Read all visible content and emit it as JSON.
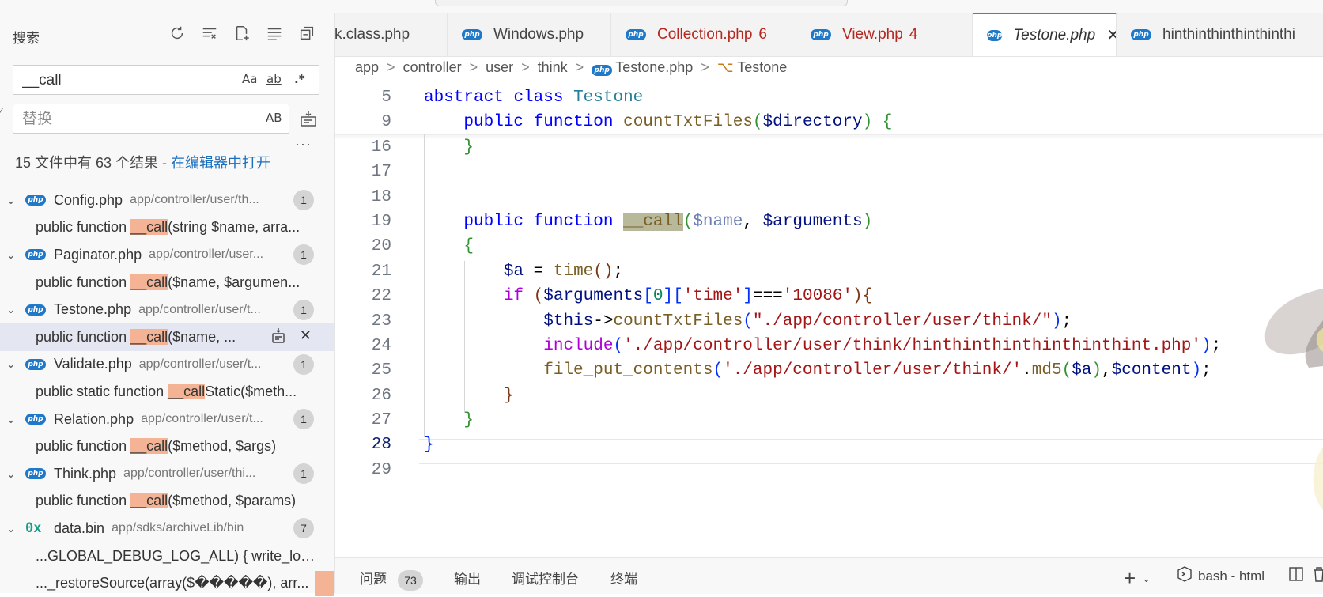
{
  "sidebar": {
    "title": "搜索",
    "search": {
      "value": "__call",
      "opt_case": "Aa",
      "opt_word": "ab",
      "opt_regex": ".*"
    },
    "replace": {
      "placeholder": "替换",
      "opt_preserve": "AB"
    },
    "more": "···",
    "summary": "15 文件中有 63 个结果 - ",
    "summary_link": "在编辑器中打开",
    "results": [
      {
        "file": "Config.php",
        "path": "app/controller/user/th...",
        "count": "1",
        "icon": "php",
        "match_pre": "public function ",
        "match_hl": "__call",
        "match_post": "(string $name, arra...",
        "selected": false
      },
      {
        "file": "Paginator.php",
        "path": "app/controller/user...",
        "count": "1",
        "icon": "php",
        "match_pre": "public function ",
        "match_hl": "__call",
        "match_post": "($name, $argumen...",
        "selected": false
      },
      {
        "file": "Testone.php",
        "path": "app/controller/user/t...",
        "count": "1",
        "icon": "php",
        "match_pre": "public function ",
        "match_hl": "__call",
        "match_post": "($name, ...",
        "selected": true
      },
      {
        "file": "Validate.php",
        "path": "app/controller/user/t...",
        "count": "1",
        "icon": "php",
        "match_pre": "public static function ",
        "match_hl": "__call",
        "match_post": "Static($meth...",
        "selected": false
      },
      {
        "file": "Relation.php",
        "path": "app/controller/user/t...",
        "count": "1",
        "icon": "php",
        "match_pre": "public function ",
        "match_hl": "__call",
        "match_post": "($method, $args)",
        "selected": false
      },
      {
        "file": "Think.php",
        "path": "app/controller/user/thi...",
        "count": "1",
        "icon": "php",
        "match_pre": "public function ",
        "match_hl": "__call",
        "match_post": "($method, $params)",
        "selected": false
      },
      {
        "file": "data.bin",
        "path": "app/sdks/archiveLib/bin",
        "count": "7",
        "icon": "0x",
        "match_pre": "...GLOBAL_DEBUG_LOG_ALL) { write_log(...",
        "match_hl": "",
        "match_post": "",
        "selected": false
      }
    ],
    "extra_match": "..._restoreSource(array($�����), arr..."
  },
  "tabs": [
    {
      "label": "k.class.php",
      "badge": "",
      "modified": false,
      "active": false,
      "icon": false
    },
    {
      "label": "Windows.php",
      "badge": "",
      "modified": false,
      "active": false,
      "icon": true
    },
    {
      "label": "Collection.php",
      "badge": "6",
      "modified": true,
      "active": false,
      "icon": true
    },
    {
      "label": "View.php",
      "badge": "4",
      "modified": true,
      "active": false,
      "icon": true
    },
    {
      "label": "Testone.php",
      "badge": "",
      "modified": false,
      "active": true,
      "icon": true
    },
    {
      "label": "hinthinthinthinthinthi",
      "badge": "",
      "modified": false,
      "active": false,
      "icon": true
    }
  ],
  "breadcrumb": [
    "app",
    "controller",
    "user",
    "think",
    "Testone.php",
    "Testone"
  ],
  "code": {
    "line_numbers": [
      "5",
      "9",
      "16",
      "17",
      "18",
      "19",
      "20",
      "21",
      "22",
      "23",
      "24",
      "25",
      "26",
      "27",
      "28",
      "29"
    ]
  },
  "panel": {
    "problems": "问题",
    "problems_count": "73",
    "output": "输出",
    "debug_console": "调试控制台",
    "terminal": "终端",
    "add": "+",
    "terminal_name": "bash - html"
  }
}
